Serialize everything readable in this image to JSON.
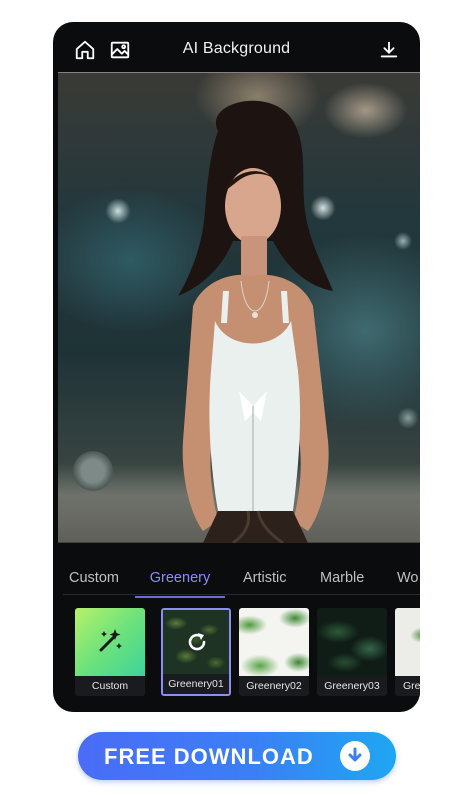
{
  "header": {
    "title": "AI Background"
  },
  "tabs": [
    {
      "label": "Custom",
      "active": false
    },
    {
      "label": "Greenery",
      "active": true
    },
    {
      "label": "Artistic",
      "active": false
    },
    {
      "label": "Marble",
      "active": false
    },
    {
      "label": "Wo",
      "active": false
    }
  ],
  "thumbnails": [
    {
      "label": "Custom",
      "icon": "magic-wand-icon"
    },
    {
      "label": "Greenery01",
      "selected": true,
      "icon": "refresh-icon"
    },
    {
      "label": "Greenery02"
    },
    {
      "label": "Greenery03"
    },
    {
      "label": "Gre"
    }
  ],
  "cta": {
    "label": "FREE DOWNLOAD",
    "icon": "download-arrow-icon"
  },
  "colors": {
    "accent": "#8d8cff",
    "cta_start": "#4a6cf7",
    "cta_end": "#1ea7f2",
    "app_bg": "#0b0c0e"
  }
}
